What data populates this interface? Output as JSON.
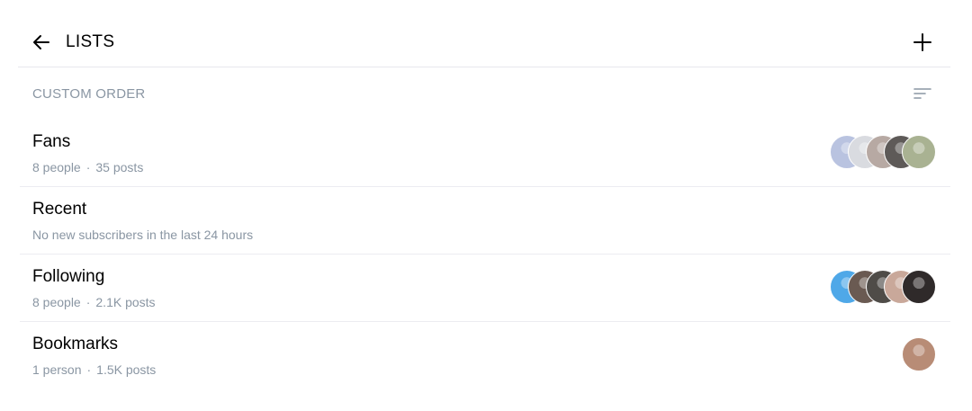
{
  "header": {
    "title": "LISTS",
    "back_icon": "arrow-left-icon",
    "add_icon": "plus-icon"
  },
  "sort": {
    "label": "CUSTOM ORDER",
    "icon": "sort-lines-icon"
  },
  "lists": [
    {
      "name": "Fans",
      "count": "8 people",
      "posts": "35 posts",
      "avatars": [
        {
          "color": "#b9c3e0"
        },
        {
          "color": "#d9dbe0"
        },
        {
          "color": "#b7a9a3"
        },
        {
          "color": "#5e5a58"
        },
        {
          "color": "#a9b292"
        }
      ]
    },
    {
      "name": "Recent",
      "subtitle": "No new subscribers in the last 24 hours",
      "avatars": []
    },
    {
      "name": "Following",
      "count": "8 people",
      "posts": "2.1K posts",
      "avatars": [
        {
          "color": "#4fa8e8"
        },
        {
          "color": "#6a5a52"
        },
        {
          "color": "#4f4c48"
        },
        {
          "color": "#c9a89a"
        },
        {
          "color": "#2f2a2a"
        }
      ]
    },
    {
      "name": "Bookmarks",
      "count": "1 person",
      "posts": "1.5K posts",
      "avatars": [
        {
          "color": "#b88c76"
        }
      ]
    }
  ],
  "colors": {
    "accent": "#00aff0",
    "muted_text": "#8a96a3",
    "divider": "#ececf1"
  }
}
